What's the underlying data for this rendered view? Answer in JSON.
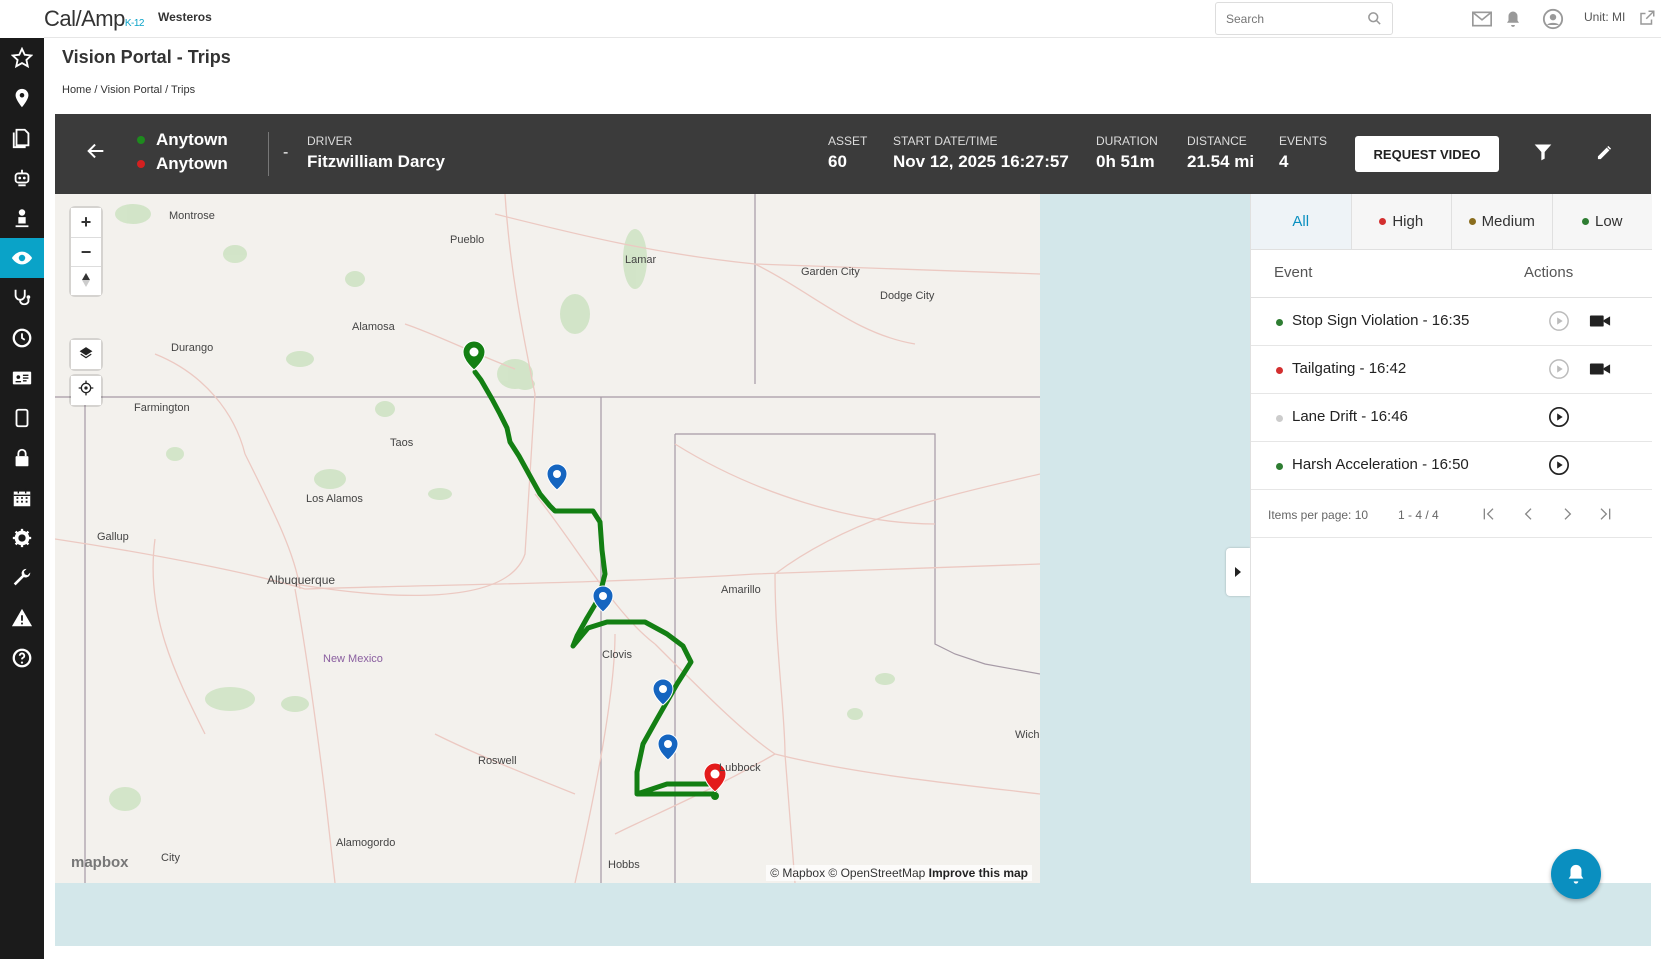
{
  "app": {
    "logo": "Cal/Amp",
    "logo_suffix": "K-12",
    "org": "Westeros"
  },
  "topbar": {
    "search_placeholder": "Search",
    "unit_label": "Unit: MI",
    "icons": [
      "mail-icon",
      "bell-icon",
      "user-icon",
      "external-link-icon"
    ]
  },
  "sidebar": {
    "items": [
      "star-icon",
      "location-icon",
      "documents-icon",
      "robot-icon",
      "person-icon",
      "eye-icon",
      "stethoscope-icon",
      "clock-icon",
      "id-card-icon",
      "tablet-icon",
      "lock-icon",
      "calendar-icon",
      "gear-icon",
      "wrench-icon",
      "warning-icon",
      "help-icon"
    ],
    "active": "eye-icon"
  },
  "page": {
    "title": "Vision Portal - Trips",
    "breadcrumb": "Home / Vision Portal / Trips"
  },
  "trip": {
    "origin": "Anytown",
    "destination": "Anytown",
    "separator": "-",
    "driver_label": "DRIVER",
    "driver": "Fitzwilliam Darcy",
    "asset_label": "ASSET",
    "asset": "60",
    "start_label": "START DATE/TIME",
    "start": "Nov 12, 2025 16:27:57",
    "duration_label": "DURATION",
    "duration": "0h 51m",
    "distance_label": "DISTANCE",
    "distance": "21.54 mi",
    "events_label": "EVENTS",
    "events": "4",
    "request_video": "REQUEST VIDEO",
    "colors": {
      "origin": "#1e8a1e",
      "destination": "#d32020",
      "bar": "#3b3b3b"
    }
  },
  "map": {
    "zoom_in": "+",
    "zoom_out": "−",
    "cities": [
      "Montrose",
      "Pueblo",
      "Lamar",
      "Garden City",
      "Dodge City",
      "Durango",
      "Alamosa",
      "Farmington",
      "Taos",
      "Los Alamos",
      "Gallup",
      "Albuquerque",
      "Amarillo",
      "New Mexico",
      "Clovis",
      "Roswell",
      "Lubbock",
      "Alamogordo",
      "Hobbs",
      "City",
      "Wichi"
    ],
    "attribution": "© Mapbox © OpenStreetMap",
    "improve": "Improve this map",
    "mapbox_logo": "mapbox",
    "route_color": "#137f13"
  },
  "panel": {
    "tabs": [
      {
        "label": "All",
        "color": ""
      },
      {
        "label": "High",
        "color": "#d32f2f"
      },
      {
        "label": "Medium",
        "color": "#8a6d1e"
      },
      {
        "label": "Low",
        "color": "#2e7d32"
      }
    ],
    "col_event": "Event",
    "col_actions": "Actions",
    "events": [
      {
        "label": "Stop Sign Violation - 16:35",
        "color": "#2e7d32",
        "has_video": true
      },
      {
        "label": "Tailgating - 16:42",
        "color": "#d32f2f",
        "has_video": true
      },
      {
        "label": "Lane Drift - 16:46",
        "color": "#cccccc",
        "has_video": false
      },
      {
        "label": "Harsh Acceleration - 16:50",
        "color": "#2e7d32",
        "has_video": false
      }
    ],
    "pager": {
      "items_per_page": "Items per page: 10",
      "range": "1 - 4 / 4"
    }
  }
}
